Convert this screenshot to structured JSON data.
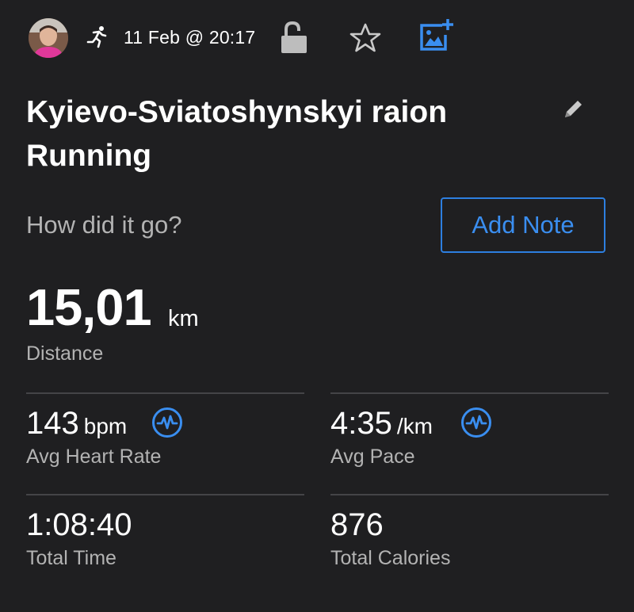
{
  "header": {
    "date_text": "11 Feb @ 20:17",
    "icons": [
      "avatar",
      "running-icon",
      "unlock-icon",
      "star-icon",
      "add-photo-icon"
    ]
  },
  "activity": {
    "title": "Kyievo-Sviatoshynskyi raion Running",
    "note_prompt": "How did it go?",
    "add_note_label": "Add Note"
  },
  "distance": {
    "value": "15,01",
    "unit": "km",
    "label": "Distance"
  },
  "stats": {
    "heart_rate": {
      "value": "143",
      "unit": "bpm",
      "label": "Avg Heart Rate"
    },
    "pace": {
      "value": "4:35",
      "unit": "/km",
      "label": "Avg Pace"
    },
    "time": {
      "value": "1:08:40",
      "label": "Total Time"
    },
    "calories": {
      "value": "876",
      "label": "Total Calories"
    }
  },
  "colors": {
    "background": "#1f1f21",
    "accent_blue": "#3a8ef0",
    "secondary_text": "#b3b3b3",
    "divider": "#444447"
  }
}
